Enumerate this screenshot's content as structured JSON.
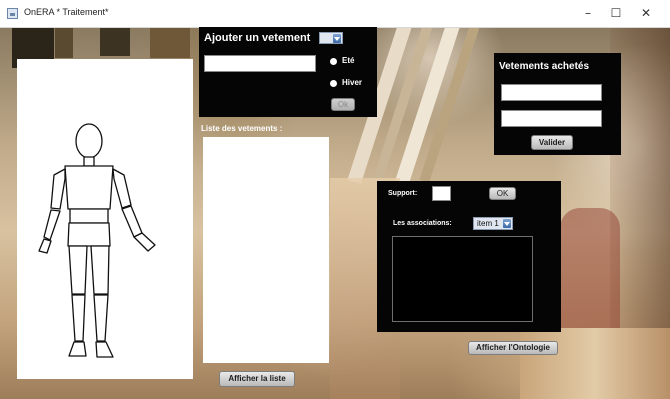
{
  "window": {
    "title": "OnERA * Traitement*",
    "minimize_glyph": "–",
    "maximize_glyph": "☐",
    "close_glyph": "✕"
  },
  "add_garment": {
    "title": "Ajouter un vetement",
    "name_value": "",
    "season_options": [
      "Eté",
      "Hiver"
    ],
    "ok_label": "Ok",
    "ok_enabled": false
  },
  "garment_list": {
    "label": "Liste des vetements :",
    "items": [],
    "show_button": "Afficher la liste"
  },
  "purchased": {
    "title": "Vetements achetés",
    "field1_value": "",
    "field2_value": "",
    "validate_button": "Valider"
  },
  "associations": {
    "support_label": "Support:",
    "support_value": "",
    "ok_label": "OK",
    "assoc_label": "Les associations:",
    "selected": "item 1",
    "results": ""
  },
  "ontology_button": "Afficher l'Ontologie",
  "icons": {
    "app": "app-window-icon",
    "combo": "chevron-down-icon"
  },
  "colors": {
    "panel_black": "#050505",
    "combo_arrow": "#3b69a8"
  }
}
